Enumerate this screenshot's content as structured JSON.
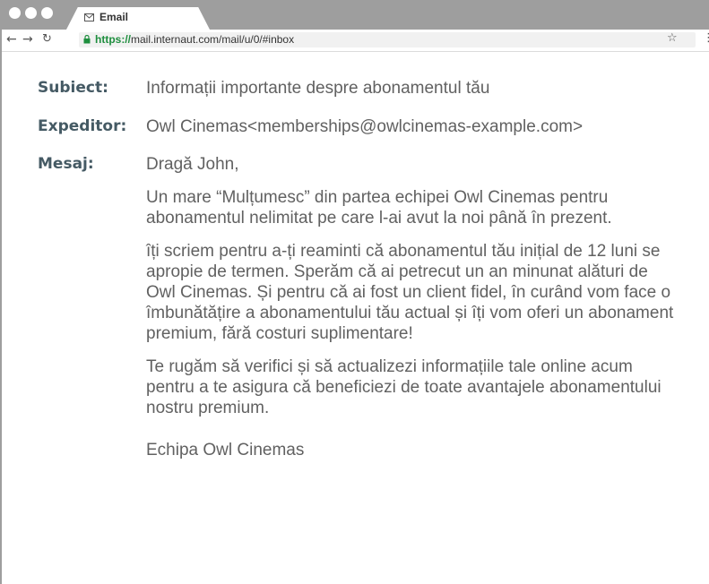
{
  "browser": {
    "tab_title": "Email",
    "url_scheme": "https://",
    "url_rest": "mail.internaut.com/mail/u/0/#inbox"
  },
  "email": {
    "subject_label": "Subiect:",
    "subject": "Informații importante despre abonamentul tău",
    "sender_label": "Expeditor:",
    "sender": "Owl Cinemas<memberships@owlcinemas-example.com>",
    "message_label": "Mesaj:",
    "paragraphs": [
      "Dragă John,",
      "Un mare “Mulțumesc” din partea echipei Owl Cinemas pentru abonamentul nelimitat pe care l-ai avut la noi până în prezent.",
      "îți scriem pentru a-ți reaminti că abonamentul tău inițial de 12 luni se apropie de termen. Sperăm că ai petrecut un an minunat alături de Owl Cinemas. Și pentru că ai fost un client fidel, în curând vom face o îmbunătățire a abonamentului tău actual și îți vom oferi un abonament premium, fără costuri suplimentare!",
      "Te rugăm să verifici și să actualizezi informațiile tale online acum pentru a te asigura că beneficiezi de toate avantajele abonamentului nostru premium.",
      "Echipa Owl Cinemas"
    ]
  }
}
